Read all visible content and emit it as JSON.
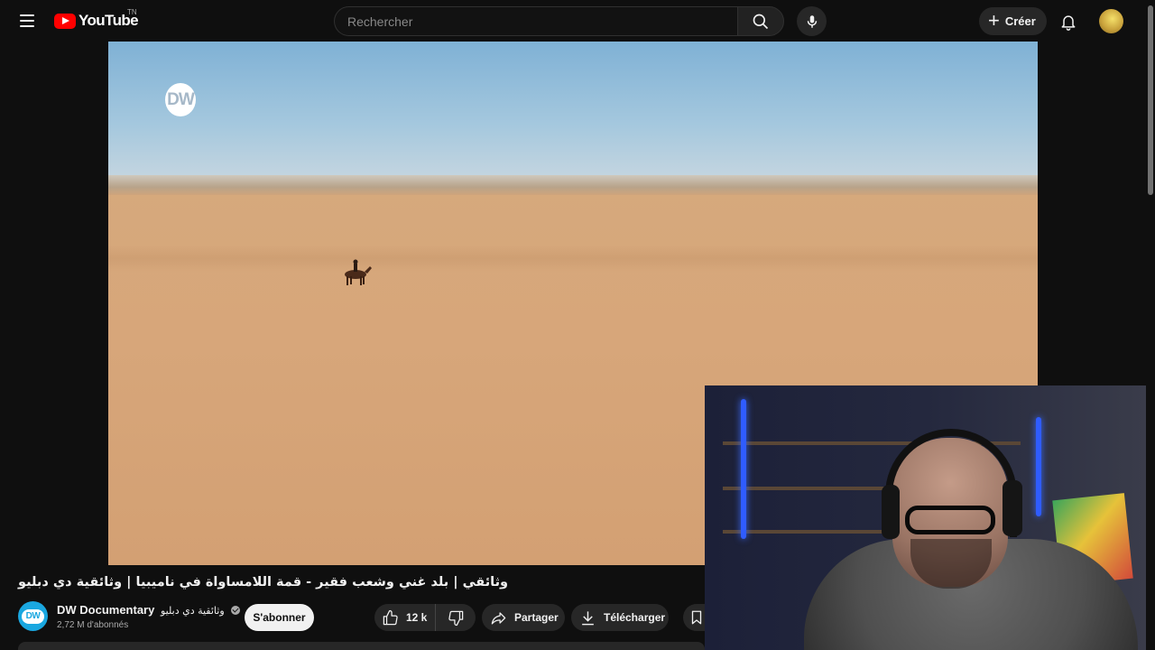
{
  "header": {
    "logo_text": "YouTube",
    "logo_region": "TN",
    "search_placeholder": "Rechercher",
    "create_label": "Créer",
    "icons": [
      "menu-icon",
      "search-icon",
      "mic-icon",
      "plus-icon",
      "bell-icon"
    ]
  },
  "video": {
    "overlay_logo": "DW",
    "title": "وثائقي | بلد غني وشعب فقير - قمة اللامساواة في ناميبيا | وثائقية دي دبليو"
  },
  "channel": {
    "avatar_text": "DW",
    "name": "DW Documentary",
    "name_arabic": "وثائقية دي دبليو",
    "subscribers": "2,72 M d'abonnés",
    "subscribe_label": "S'abonner"
  },
  "actions": {
    "likes": "12 k",
    "share_label": "Partager",
    "download_label": "Télécharger"
  },
  "colors": {
    "background": "#0f0f0f",
    "pill": "#272727",
    "brand_red": "#ff0000",
    "channel_blue": "#1aa7e0"
  }
}
